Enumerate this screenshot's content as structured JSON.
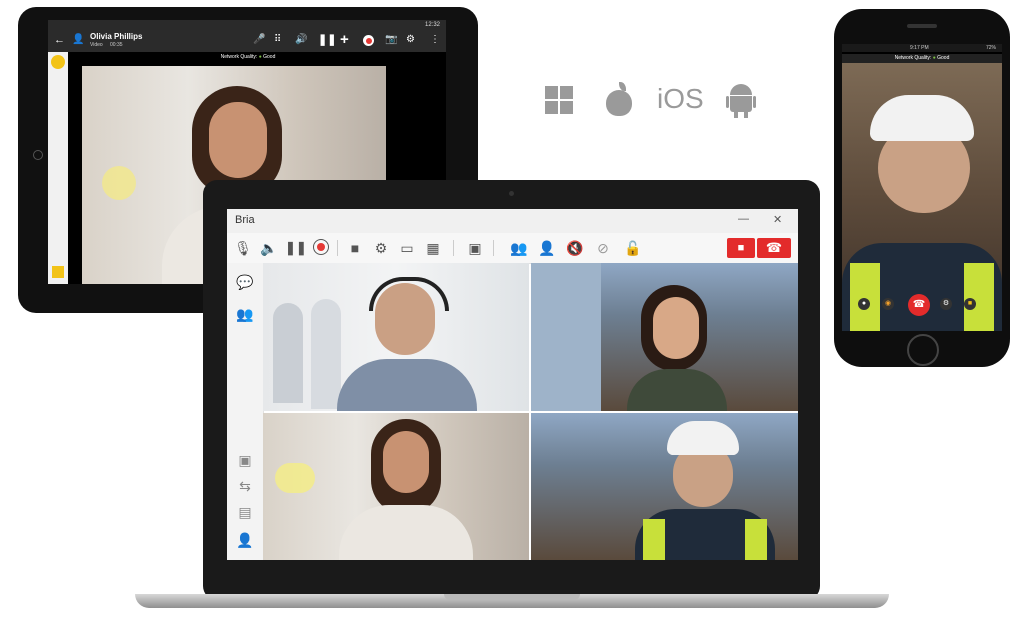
{
  "tablet": {
    "caller_name": "Olivia Phillips",
    "call_type": "Video",
    "call_duration": "00:35",
    "clock": "12:32",
    "network_label": "Network Quality:",
    "network_value": "Good"
  },
  "laptop": {
    "app_title": "Bria",
    "minimize_glyph": "—",
    "close_glyph": "✕"
  },
  "platforms": {
    "ios_label": "iOS"
  },
  "phone": {
    "status_time": "9:17 PM",
    "battery": "72%",
    "network_label": "Network Quality:",
    "network_value": "Good"
  },
  "colors": {
    "end_call_red": "#e32b2b",
    "record_red": "#e53935",
    "icon_gray": "#9a9a9a"
  }
}
